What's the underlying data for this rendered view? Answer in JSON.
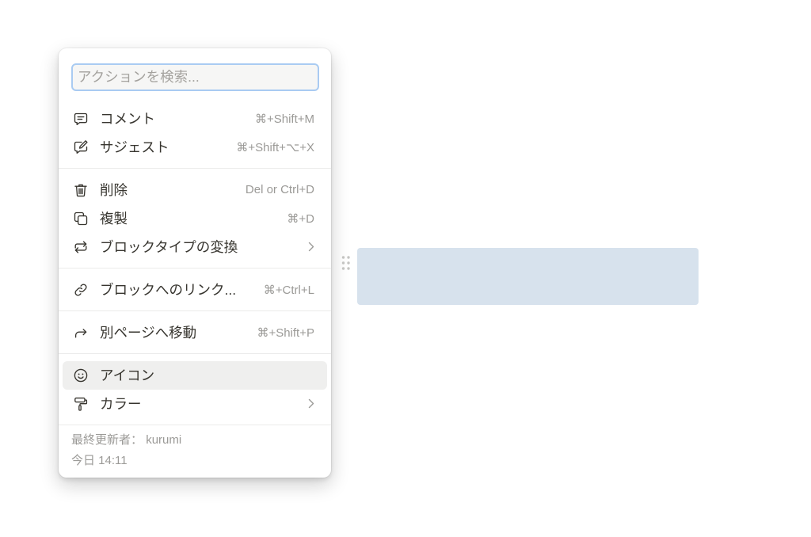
{
  "search": {
    "placeholder": "アクションを検索..."
  },
  "menu": {
    "comment": {
      "label": "コメント",
      "shortcut": "⌘+Shift+M",
      "icon": "comment-icon"
    },
    "suggest": {
      "label": "サジェスト",
      "shortcut": "⌘+Shift+⌥+X",
      "icon": "suggest-edit-icon"
    },
    "delete": {
      "label": "削除",
      "shortcut": "Del or Ctrl+D",
      "icon": "trash-icon"
    },
    "duplicate": {
      "label": "複製",
      "shortcut": "⌘+D",
      "icon": "duplicate-icon"
    },
    "turn_into": {
      "label": "ブロックタイプの変換",
      "submenu": true,
      "icon": "turn-into-icon"
    },
    "copy_link": {
      "label": "ブロックへのリンク...",
      "shortcut": "⌘+Ctrl+L",
      "icon": "link-icon"
    },
    "move_to": {
      "label": "別ページへ移動",
      "shortcut": "⌘+Shift+P",
      "icon": "move-to-icon"
    },
    "icon": {
      "label": "アイコン",
      "icon": "smiley-icon",
      "hovered": true
    },
    "color": {
      "label": "カラー",
      "submenu": true,
      "icon": "paint-roller-icon"
    }
  },
  "footer": {
    "last_edited_label": "最終更新者：",
    "last_edited_by": "kurumi",
    "last_edited_time": "今日 14:11"
  },
  "block": {
    "selected": true
  },
  "colors": {
    "text": "#37352f",
    "muted_text": "#9b9a97",
    "focus_ring": "#a9cbf2",
    "hover_background": "#efefee",
    "divider": "#ebebea",
    "selected_block": "#d7e2ed",
    "drag_handle": "#c4c4c2"
  }
}
